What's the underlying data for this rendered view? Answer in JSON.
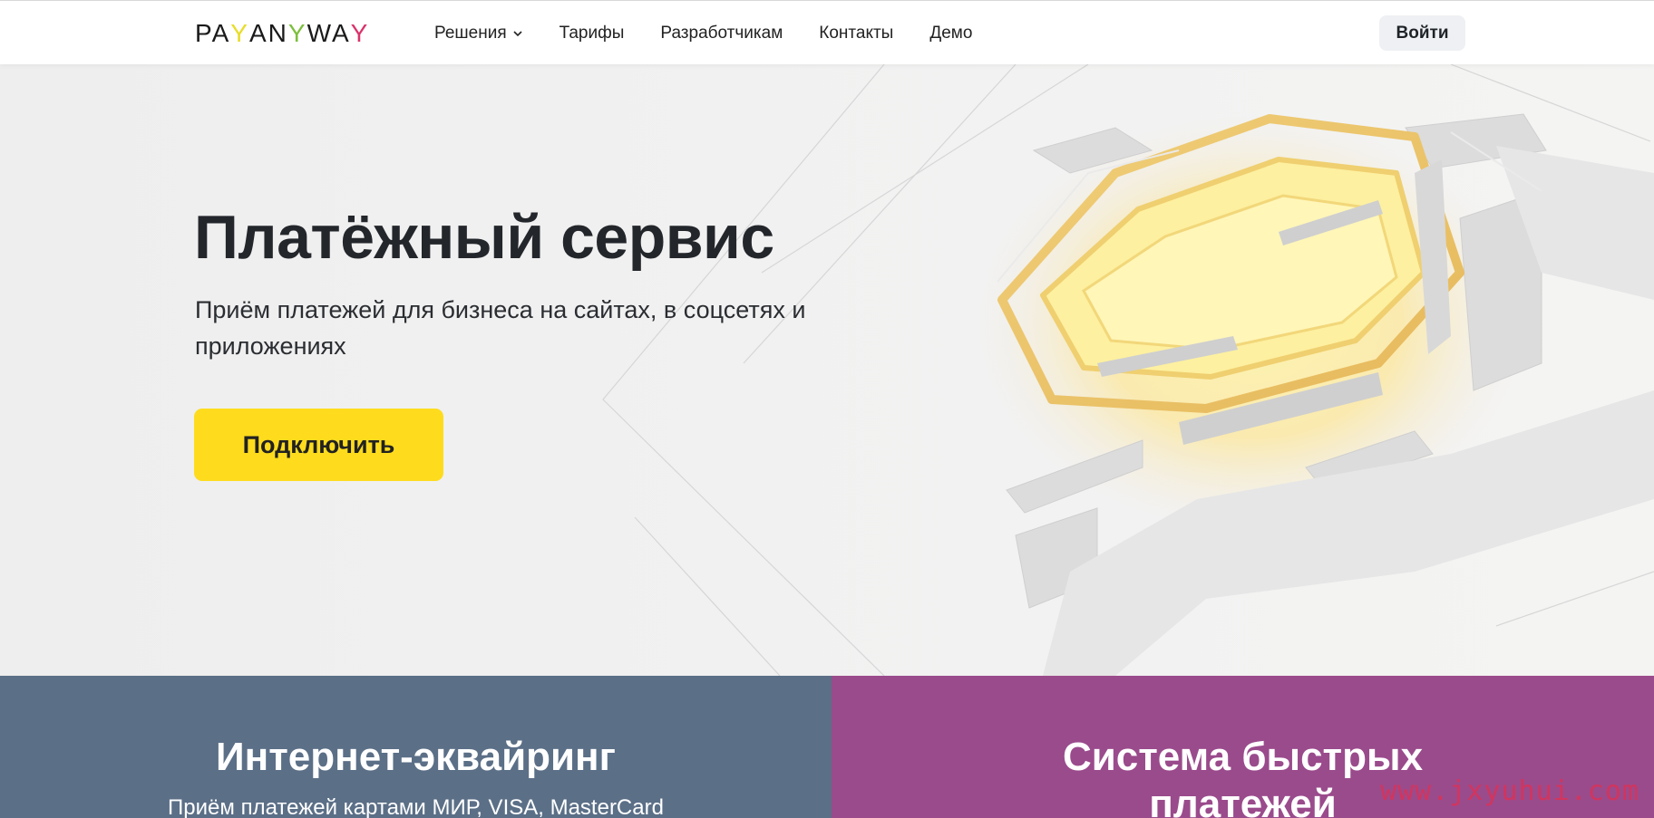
{
  "header": {
    "logo": {
      "text_pre": "PA",
      "y1": "Y",
      "mid": "AN",
      "y2": "Y",
      "w": "WA",
      "y3": "Y"
    },
    "nav": [
      {
        "label": "Решения",
        "has_dropdown": true
      },
      {
        "label": "Тарифы"
      },
      {
        "label": "Разработчикам"
      },
      {
        "label": "Контакты"
      },
      {
        "label": "Демо"
      }
    ],
    "login_label": "Войти"
  },
  "hero": {
    "title": "Платёжный сервис",
    "subtitle": "Приём платежей для бизнеса на сайтах, в соцсетях и приложениях",
    "cta_label": "Подключить"
  },
  "panels": [
    {
      "title": "Интернет-эквайринг",
      "description": "Приём платежей картами МИР, VISA, MasterCard"
    },
    {
      "title": "Система быстрых платежей"
    }
  ],
  "watermark": "www.jxyuhui.com",
  "colors": {
    "accent_yellow": "#fedc1d",
    "panel_left": "#5b6f87",
    "panel_right": "#9a4b8c",
    "watermark": "#d8335a"
  }
}
